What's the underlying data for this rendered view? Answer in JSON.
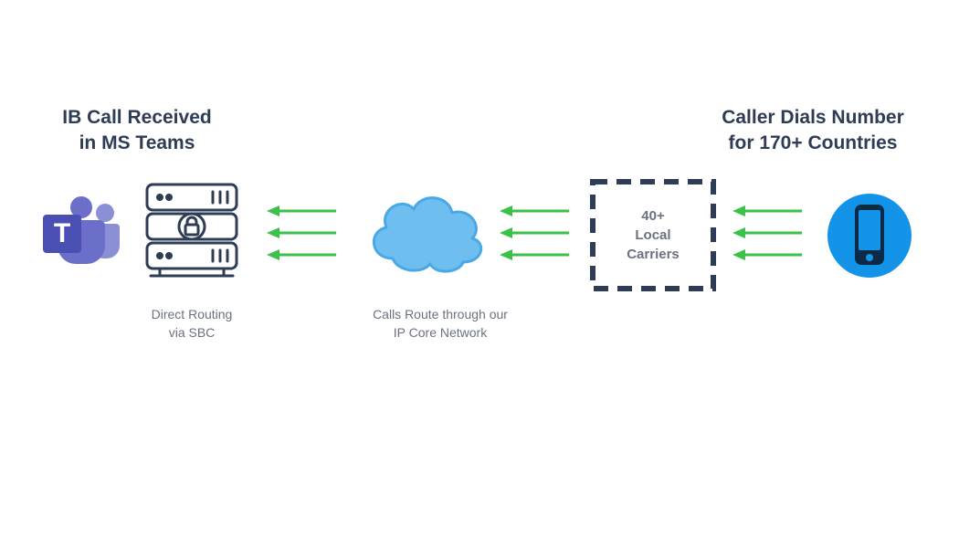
{
  "headings": {
    "left_line1": "IB Call Received",
    "left_line2": "in MS Teams",
    "right_line1": "Caller Dials Number",
    "right_line2": "for 170+ Countries"
  },
  "captions": {
    "sbc_line1": "Direct Routing",
    "sbc_line2": "via SBC",
    "cloud_line1": "Calls Route through our",
    "cloud_line2": "IP Core Network"
  },
  "carriers": {
    "count": "40+",
    "line2": "Local",
    "line3": "Carriers"
  },
  "icons": {
    "teams_letter": "T"
  },
  "colors": {
    "heading": "#2e3d55",
    "caption": "#6b7280",
    "teams_purple": "#6b6fc9",
    "teams_purple_light": "#8b8fd6",
    "server_outline": "#2e3d55",
    "arrow_green": "#3bc14a",
    "cloud_fill": "#6ebef0",
    "cloud_stroke": "#49a8e6",
    "dashed_stroke": "#2e3d55",
    "phone_bg": "#1394e8",
    "phone_fg": "#0a2a45"
  }
}
